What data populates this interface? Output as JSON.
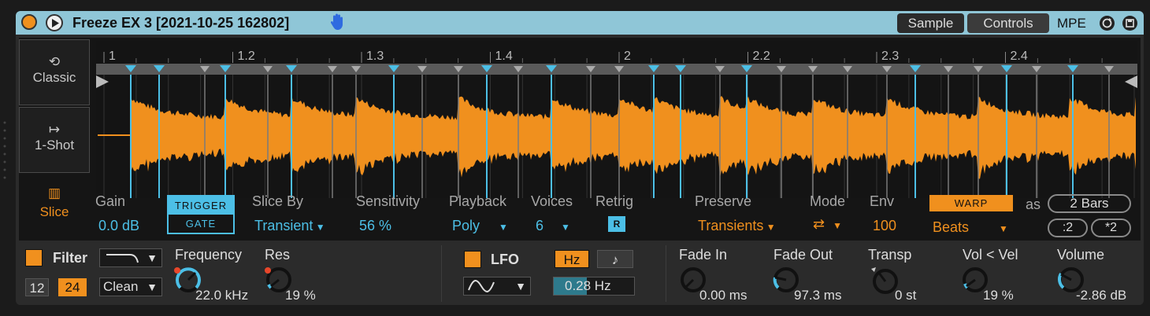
{
  "device": {
    "title": "Freeze EX 3 [2021-10-25 162802]",
    "tabs": [
      "Sample",
      "Controls"
    ],
    "mpe": "MPE"
  },
  "modes": {
    "classic": "Classic",
    "one_shot": "1-Shot",
    "slice": "Slice"
  },
  "ruler": [
    "1",
    "1.2",
    "1.3",
    "1.4",
    "2",
    "2.2",
    "2.3",
    "2.4"
  ],
  "colors": {
    "accent": "#f0901e",
    "highlight": "#4cbfe6",
    "title_bar": "#8fc6d7"
  },
  "params": {
    "gain_label": "Gain",
    "gain_value": "0.0 dB",
    "trigger": "TRIGGER",
    "gate": "GATE",
    "slice_by_label": "Slice By",
    "slice_by_value": "Transient",
    "sensitivity_label": "Sensitivity",
    "sensitivity_value": "56 %",
    "playback_label": "Playback",
    "playback_value": "Poly",
    "voices_label": "Voices",
    "voices_value": "6",
    "retrig_label": "Retrig",
    "retrig_value": "R",
    "preserve_label": "Preserve",
    "preserve_value": "Transients",
    "mode_label": "Mode",
    "env_label": "Env",
    "env_value": "100",
    "warp": "WARP",
    "warp_mode": "Beats",
    "as_label": "as",
    "bars": "2 Bars",
    "half": ":2",
    "double": "*2"
  },
  "filter": {
    "label": "Filter",
    "slope_12": "12",
    "slope_24": "24",
    "type": "Clean",
    "freq_label": "Frequency",
    "freq_value": "22.0 kHz",
    "res_label": "Res",
    "res_value": "19 %"
  },
  "lfo": {
    "label": "LFO",
    "hz": "Hz",
    "rate": "0.28 Hz"
  },
  "envelope": {
    "fade_in_label": "Fade In",
    "fade_in_value": "0.00 ms",
    "fade_out_label": "Fade Out",
    "fade_out_value": "97.3 ms",
    "transp_label": "Transp",
    "transp_value": "0 st",
    "vol_vel_label": "Vol < Vel",
    "vol_vel_value": "19 %",
    "volume_label": "Volume",
    "volume_value": "-2.86 dB"
  }
}
